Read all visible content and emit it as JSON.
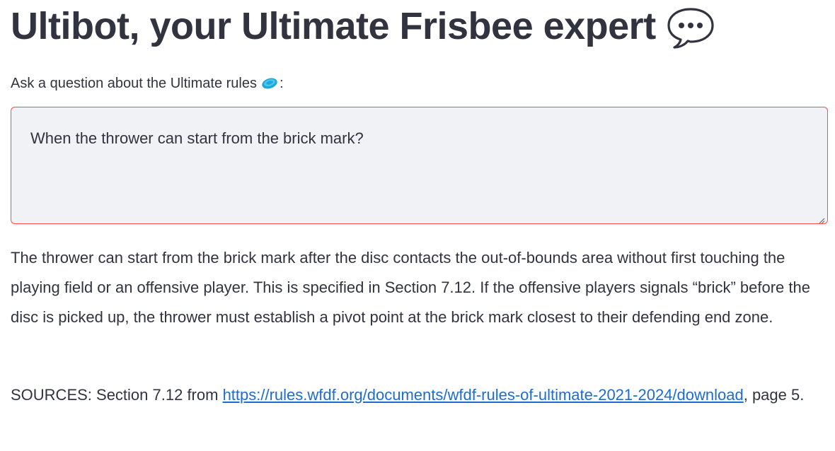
{
  "header": {
    "title": "Ultibot, your Ultimate Frisbee expert",
    "title_icon": "speech-bubble-icon"
  },
  "question_input": {
    "label": "Ask a question about the Ultimate rules",
    "label_suffix": ":",
    "label_icon": "frisbee-icon",
    "value": "When the thrower can start from the brick mark?",
    "border_color": "#ff4b4b",
    "background_color": "#f0f2f6"
  },
  "answer": {
    "text": "The thrower can start from the brick mark after the disc contacts the out-of-bounds area without first touching the playing field or an offensive player. This is specified in Section 7.12. If the offensive players signals “brick” before the disc is picked up, the thrower must establish a pivot point at the brick mark closest to their defending end zone."
  },
  "sources": {
    "prefix": "SOURCES: Section 7.12 from ",
    "link_text": "https://rules.wfdf.org/documents/wfdf-rules-of-ultimate-2021-2024/download",
    "suffix": ", page 5.",
    "link_color": "#1c6dd0"
  }
}
